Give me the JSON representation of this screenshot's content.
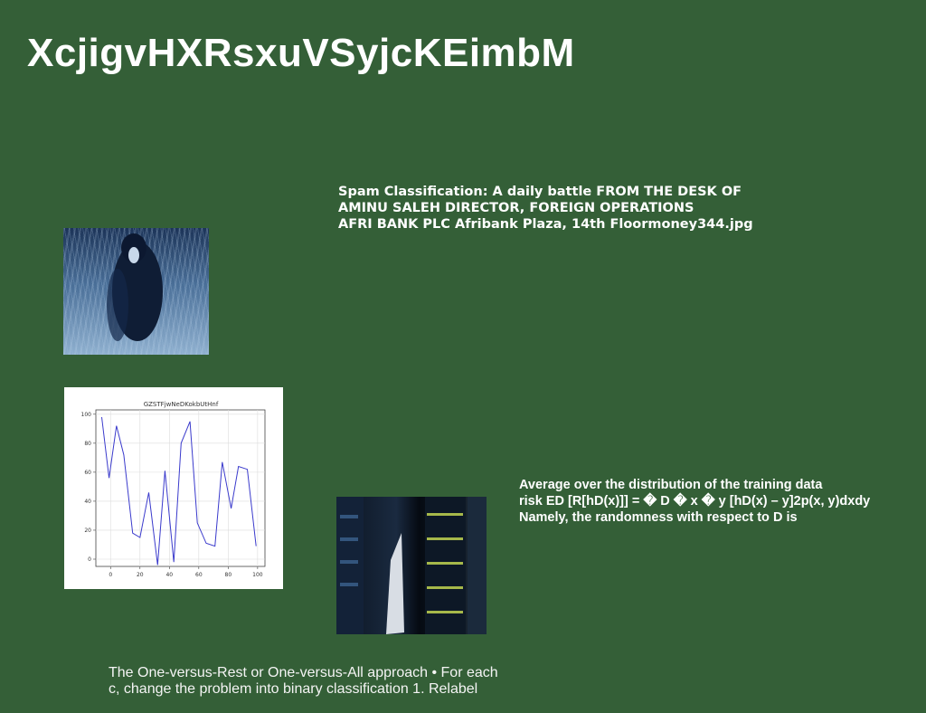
{
  "title": "XcjigvHXRsxuVSyjcKEimbM",
  "text_block_1": "Spam Classification: A daily battle FROM THE DESK OF\nAMINU SALEH DIRECTOR, FOREIGN OPERATIONS\nAFRI BANK PLC Afribank Plaza, 14th Floormoney344.jpg",
  "text_block_2": "Average over the distribution of the training data\nrisk ED [R[hD(x)]] = � D � x � y [hD(x) – y]2p(x, y)dxdy\nNamely, the randomness with respect to D is",
  "text_block_3": "The One-versus-Rest or One-versus-All approach • For each\nc, change the problem into binary classification 1. Relabel",
  "colors": {
    "background": "#345f37",
    "line": "#3a3acc"
  },
  "chart_data": {
    "type": "line",
    "title": "GZSTFjwNeDKokbUtHnf",
    "xlabel": "",
    "ylabel": "",
    "xlim": [
      -10,
      105
    ],
    "ylim": [
      -5,
      103
    ],
    "x_ticks": [
      0,
      20,
      40,
      60,
      80,
      100
    ],
    "y_ticks": [
      0,
      20,
      40,
      60,
      80,
      100
    ],
    "grid": true,
    "series": [
      {
        "x": [
          -6,
          -1,
          4,
          9,
          15,
          20,
          26,
          32,
          37,
          43,
          48,
          54,
          59,
          65,
          71,
          76,
          82,
          87,
          93,
          99
        ],
        "y": [
          98,
          56,
          92,
          72,
          18,
          15,
          46,
          -4,
          61,
          -2,
          80,
          95,
          25,
          11,
          9,
          67,
          35,
          64,
          62,
          9
        ]
      }
    ]
  }
}
